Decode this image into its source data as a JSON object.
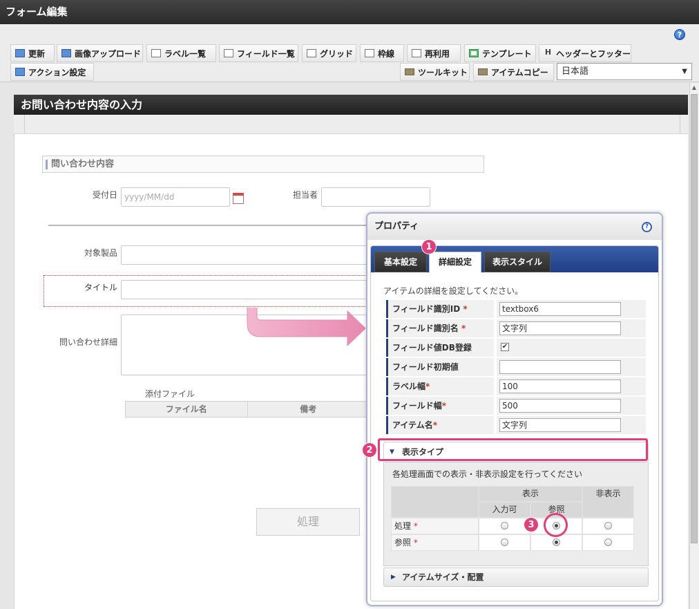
{
  "window": {
    "title": "フォーム編集"
  },
  "toolbar": {
    "row1": [
      "更新",
      "画像アップロード",
      "ラベル一覧",
      "フィールド一覧",
      "グリッド",
      "枠線",
      "再利用",
      "テンプレート",
      "ヘッダーとフッター"
    ],
    "row2_left": [
      "アクション設定"
    ],
    "row2_right": [
      "ツールキット",
      "アイテムコピー"
    ],
    "language": "日本語",
    "help": "?"
  },
  "form": {
    "header": "お問い合わせ内容の入力",
    "section": "問い合わせ内容",
    "fields": {
      "received_date_label": "受付日",
      "received_date_placeholder": "yyyy/MM/dd",
      "assignee_label": "担当者",
      "product_label": "対象製品",
      "title_label": "タイトル",
      "detail_label": "問い合わせ詳細",
      "attachment_label": "添付ファイル"
    },
    "attachment_columns": [
      "ファイル名",
      "備考"
    ],
    "process_button": "処理"
  },
  "properties": {
    "title": "プロパティ",
    "help": "?",
    "tabs": [
      "基本設定",
      "詳細設定",
      "表示スタイル"
    ],
    "active_tab": "詳細設定",
    "description": "アイテムの詳細を設定してください。",
    "rows": [
      {
        "label": "フィールド識別ID",
        "required": "*",
        "value": "textbox6"
      },
      {
        "label": "フィールド識別名",
        "required": "*",
        "value": "文字列"
      },
      {
        "label": "フィールド値DB登録",
        "required": "",
        "checked": "✔"
      },
      {
        "label": "フィールド初期値",
        "required": "",
        "value": ""
      },
      {
        "label": "ラベル幅",
        "required": "*",
        "value": "100"
      },
      {
        "label": "フィールド幅",
        "required": "*",
        "value": "500"
      },
      {
        "label": "アイテム名",
        "required": "*",
        "value": "文字列"
      }
    ],
    "display_type": {
      "label": "表示タイプ",
      "description": "各処理画面での表示・非表示設定を行ってください",
      "header_show": "表示",
      "header_hide": "非表示",
      "sub_input": "入力可",
      "sub_ref": "参照",
      "rows": [
        {
          "label": "処理",
          "required": "*",
          "selected": "参照"
        },
        {
          "label": "参照",
          "required": "*",
          "selected": "参照"
        }
      ]
    },
    "item_size": "アイテムサイズ・配置"
  },
  "callouts": [
    "1",
    "2",
    "3"
  ],
  "colors": {
    "callout": "#e0407a",
    "tabbar": "#2a4a94"
  }
}
